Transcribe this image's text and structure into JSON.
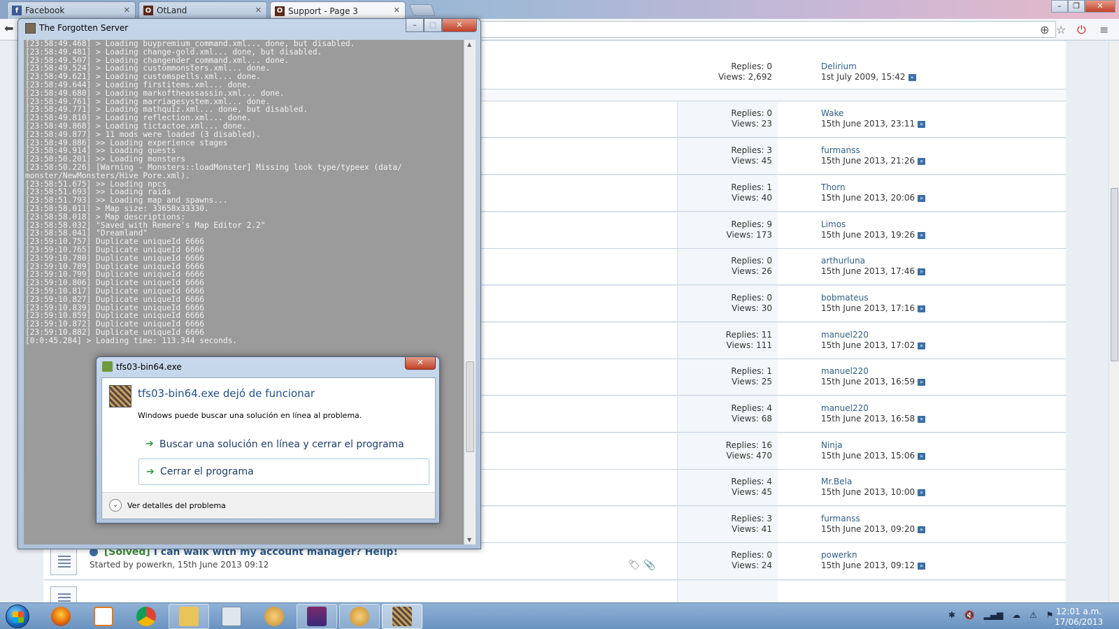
{
  "browser": {
    "tabs": [
      {
        "label": "Facebook",
        "icon": "facebook-icon",
        "active": false
      },
      {
        "label": "OtLand",
        "icon": "otland-icon",
        "active": false
      },
      {
        "label": "Support - Page 3",
        "icon": "otland-icon",
        "active": true
      }
    ]
  },
  "forum": {
    "threads": [
      {
        "replies": "Replies: 0",
        "views": "Views: 2,692",
        "last_user": "Delirium",
        "last_date": "1st July 2009, 15:42"
      },
      {
        "replies": "Replies: 0",
        "views": "Views: 23",
        "last_user": "Wake",
        "last_date": "15th June 2013, 23:11"
      },
      {
        "replies": "Replies: 3",
        "views": "Views: 45",
        "last_user": "furmanss",
        "last_date": "15th June 2013, 21:26"
      },
      {
        "replies": "Replies: 1",
        "views": "Views: 40",
        "last_user": "Thorn",
        "last_date": "15th June 2013, 20:06"
      },
      {
        "replies": "Replies: 9",
        "views": "Views: 173",
        "last_user": "Limos",
        "last_date": "15th June 2013, 19:26"
      },
      {
        "replies": "Replies: 0",
        "views": "Views: 26",
        "last_user": "arthurluna",
        "last_date": "15th June 2013, 17:46"
      },
      {
        "replies": "Replies: 0",
        "views": "Views: 30",
        "last_user": "bobmateus",
        "last_date": "15th June 2013, 17:16"
      },
      {
        "replies": "Replies: 11",
        "views": "Views: 111",
        "last_user": "manuel220",
        "last_date": "15th June 2013, 17:02"
      },
      {
        "replies": "Replies: 1",
        "views": "Views: 25",
        "last_user": "manuel220",
        "last_date": "15th June 2013, 16:59"
      },
      {
        "replies": "Replies: 4",
        "views": "Views: 68",
        "last_user": "manuel220",
        "last_date": "15th June 2013, 16:58"
      },
      {
        "replies": "Replies: 16",
        "views": "Views: 470",
        "last_user": "Ninja",
        "last_date": "15th June 2013, 15:06"
      },
      {
        "replies": "Replies: 4",
        "views": "Views: 45",
        "last_user": "Mr.Bela",
        "last_date": "15th June 2013, 10:00"
      },
      {
        "replies": "Replies: 3",
        "views": "Views: 41",
        "last_user": "furmanss",
        "last_date": "15th June 2013, 09:20"
      },
      {
        "replies": "Replies: 0",
        "views": "Views: 24",
        "last_user": "powerkn",
        "last_date": "15th June 2013, 09:12"
      }
    ],
    "visible_thread": {
      "prefix": "[Solved]",
      "title": "I can walk with my account manager? Hellp!",
      "meta": "Started by powerkn, 15th June 2013 09:12"
    }
  },
  "console": {
    "title": "The Forgotten Server",
    "lines": [
      "[23:58:49.468] > Loading buypremium_command.xml... done, but disabled.",
      "[23:58:49.481] > Loading change-gold.xml... done, but disabled.",
      "[23:58:49.507] > Loading changender_command.xml... done.",
      "[23:58:49.524] > Loading custommonsters.xml... done.",
      "[23:58:49.621] > Loading customspells.xml... done.",
      "[23:58:49.644] > Loading firstitems.xml... done.",
      "[23:58:49.680] > Loading markoftheassassin.xml... done.",
      "[23:58:49.761] > Loading marriagesystem.xml... done.",
      "[23:58:49.771] > Loading mathquiz.xml... done, but disabled.",
      "[23:58:49.810] > Loading reflection.xml... done.",
      "[23:58:49.868] > Loading tictactoe.xml... done.",
      "[23:58:49.877] > 11 mods were loaded (3 disabled).",
      "[23:58:49.886] >> Loading experience stages",
      "[23:58:49.914] >> Loading quests",
      "[23:58:50.201] >> Loading monsters",
      "[23:58:50.226] [Warning - Monsters::loadMonster] Missing look type/typeex (data/",
      "monster/NewMonsters/Hive Pore.xml).",
      "[23:58:51.675] >> Loading npcs",
      "[23:58:51.693] >> Loading raids",
      "[23:58:51.793] >> Loading map and spawns...",
      "[23:58:58.011] > Map size: 33658x33330.",
      "[23:58:58.018] > Map descriptions:",
      "[23:58:58.032] \"Saved with Remere's Map Editor 2.2\"",
      "[23:58:58.041] \"Dreamland\"",
      "[23:59:10.757] Duplicate uniqueId 6666",
      "[23:59:10.765] Duplicate uniqueId 6666",
      "[23:59:10.780] Duplicate uniqueId 6666",
      "[23:59:10.789] Duplicate uniqueId 6666",
      "[23:59:10.799] Duplicate uniqueId 6666",
      "[23:59:10.806] Duplicate uniqueId 6666",
      "[23:59:10.817] Duplicate uniqueId 6666",
      "[23:59:10.827] Duplicate uniqueId 6666",
      "[23:59:10.839] Duplicate uniqueId 6666",
      "[23:59:10.859] Duplicate uniqueId 6666",
      "[23:59:10.872] Duplicate uniqueId 6666",
      "[23:59:10.882] Duplicate uniqueId 6666",
      "[0:0:45.284] > Loading time: 113.344 seconds."
    ]
  },
  "dialog": {
    "title": "tfs03-bin64.exe",
    "heading": "tfs03-bin64.exe dejó de funcionar",
    "subtext": "Windows puede buscar una solución en línea al problema.",
    "option_search": "Buscar una solución en línea y cerrar el programa",
    "option_close": "Cerrar el programa",
    "details": "Ver detalles del problema"
  },
  "taskbar": {
    "apps": [
      "firefox-icon",
      "media-player-icon",
      "chrome-icon",
      "explorer-icon",
      "calculator-icon",
      "paint-icon",
      "winrar-icon",
      "paint-icon",
      "tfs-icon"
    ],
    "time": "12:01 a.m.",
    "date": "17/06/2013"
  },
  "colors": {
    "link": "#2e5e8a",
    "solved_prefix": "#3b8b3b",
    "console_bg": "#9b9b9b"
  }
}
